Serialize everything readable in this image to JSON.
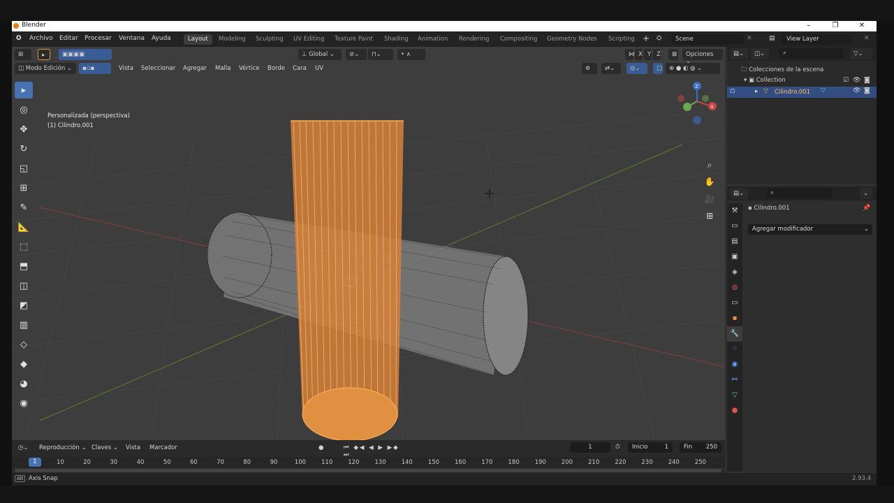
{
  "window": {
    "title": "Blender"
  },
  "menu": [
    "Archivo",
    "Editar",
    "Procesar",
    "Ventana",
    "Ayuda"
  ],
  "workspaces": [
    "Layout",
    "Modeling",
    "Sculpting",
    "UV Editing",
    "Texture Paint",
    "Shading",
    "Animation",
    "Rendering",
    "Compositing",
    "Geometry Nodes",
    "Scripting"
  ],
  "scene": "Scene",
  "view_layer": "View Layer",
  "viewport": {
    "transform_orientation": "Global",
    "axes": [
      "X",
      "Y",
      "Z"
    ],
    "options_label": "Opciones",
    "mode": "Modo Edición",
    "menus": [
      "Vista",
      "Seleccionar",
      "Agregar",
      "Malla",
      "Vértice",
      "Borde",
      "Cara",
      "UV"
    ],
    "view_name": "Personalizada (perspectiva)",
    "object_info": "(1) Cilindro.001"
  },
  "outliner": {
    "root": "Colecciones de la escena",
    "collection": "Collection",
    "object": "Cilindro.001"
  },
  "properties": {
    "object": "Cilindro.001",
    "add_modifier": "Agregar modificador"
  },
  "timeline": {
    "menus": [
      "Reproducción",
      "Claves",
      "Vista",
      "Marcador"
    ],
    "current_frame": "1",
    "start_label": "Inicio",
    "start": "1",
    "end_label": "Fin",
    "end": "250",
    "ticks": [
      "10",
      "20",
      "30",
      "40",
      "50",
      "60",
      "70",
      "80",
      "90",
      "100",
      "110",
      "120",
      "130",
      "140",
      "150",
      "160",
      "170",
      "180",
      "190",
      "200",
      "210",
      "220",
      "230",
      "240",
      "250"
    ],
    "playhead": "1"
  },
  "status": {
    "key": "Alt",
    "hint": "Axis Snap",
    "version": "2.93.4"
  },
  "colors": {
    "accent": "#4772b3",
    "selected": "#ff9d2b",
    "x_axis": "#c34b4b",
    "y_axis": "#6f9a2e"
  }
}
